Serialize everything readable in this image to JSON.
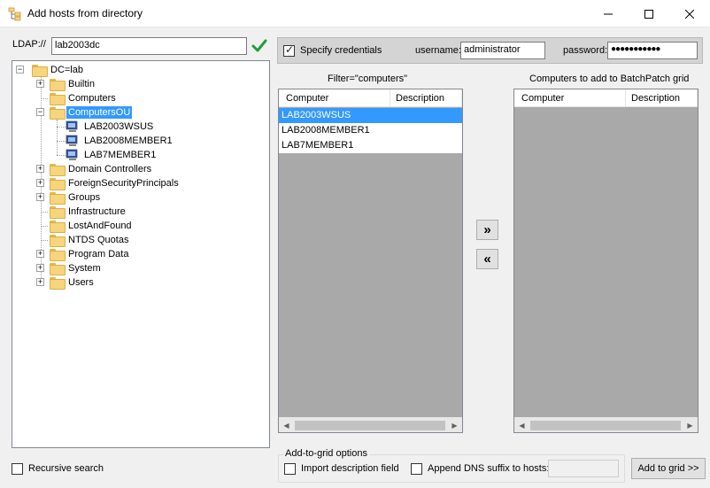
{
  "window": {
    "title": "Add hosts from directory",
    "controls": {
      "minimize": "minimize-icon",
      "maximize": "maximize-icon",
      "close": "close-icon"
    }
  },
  "ldap": {
    "label": "LDAP://",
    "value": "lab2003dc",
    "confirm_icon": "green-checkmark-icon"
  },
  "tree": {
    "root": "DC=lab",
    "nodes": [
      {
        "label": "Builtin",
        "expandable": true
      },
      {
        "label": "Computers",
        "expandable": false
      },
      {
        "label": "ComputersOU",
        "expandable": true,
        "expanded": true,
        "selected": true,
        "children": [
          "LAB2003WSUS",
          "LAB2008MEMBER1",
          "LAB7MEMBER1"
        ]
      },
      {
        "label": "Domain Controllers",
        "expandable": true
      },
      {
        "label": "ForeignSecurityPrincipals",
        "expandable": true
      },
      {
        "label": "Groups",
        "expandable": true
      },
      {
        "label": "Infrastructure",
        "expandable": false
      },
      {
        "label": "LostAndFound",
        "expandable": false
      },
      {
        "label": "NTDS Quotas",
        "expandable": false
      },
      {
        "label": "Program Data",
        "expandable": true
      },
      {
        "label": "System",
        "expandable": true
      },
      {
        "label": "Users",
        "expandable": true
      }
    ]
  },
  "recursive": {
    "label": "Recursive search",
    "checked": false
  },
  "credentials": {
    "label": "Specify credentials",
    "checked": true,
    "username_label": "username:",
    "username_value": "administrator",
    "password_label": "password:",
    "password_value": "●●●●●●●●●●●"
  },
  "filter_list": {
    "caption": "Filter=\"computers\"",
    "columns": [
      "Computer",
      "Description"
    ],
    "rows": [
      "LAB2003WSUS",
      "LAB2008MEMBER1",
      "LAB7MEMBER1"
    ],
    "selected_index": 0
  },
  "move": {
    "add": "»",
    "remove": "«"
  },
  "target_list": {
    "caption": "Computers to add to BatchPatch grid",
    "columns": [
      "Computer",
      "Description"
    ],
    "rows": []
  },
  "options": {
    "group_label": "Add-to-grid options",
    "import_description": {
      "label": "Import description field",
      "checked": false
    },
    "append_dns": {
      "label": "Append DNS suffix to hosts:",
      "checked": false,
      "value": ""
    },
    "add_button": "Add to grid >>"
  },
  "colors": {
    "selection": "#3399ff",
    "list_background": "#a9a9a9",
    "check_green": "#1e9e3a"
  }
}
